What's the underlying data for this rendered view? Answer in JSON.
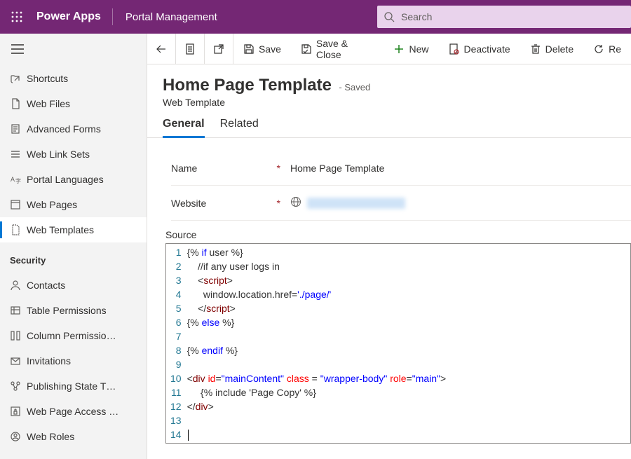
{
  "header": {
    "brand": "Power Apps",
    "app": "Portal Management",
    "search_placeholder": "Search"
  },
  "sidebar": {
    "items_top": [
      {
        "label": "Shortcuts",
        "icon": "shortcut"
      },
      {
        "label": "Web Files",
        "icon": "webfile"
      },
      {
        "label": "Advanced Forms",
        "icon": "form"
      },
      {
        "label": "Web Link Sets",
        "icon": "list"
      },
      {
        "label": "Portal Languages",
        "icon": "lang"
      },
      {
        "label": "Web Pages",
        "icon": "page"
      },
      {
        "label": "Web Templates",
        "icon": "template",
        "active": true
      }
    ],
    "section_label": "Security",
    "items_security": [
      {
        "label": "Contacts",
        "icon": "contact"
      },
      {
        "label": "Table Permissions",
        "icon": "tableperm"
      },
      {
        "label": "Column Permissio…",
        "icon": "colperm"
      },
      {
        "label": "Invitations",
        "icon": "invite"
      },
      {
        "label": "Publishing State T…",
        "icon": "pubstate"
      },
      {
        "label": "Web Page Access …",
        "icon": "access"
      },
      {
        "label": "Web Roles",
        "icon": "roles"
      }
    ]
  },
  "commands": {
    "save": "Save",
    "saveclose": "Save & Close",
    "new": "New",
    "deactivate": "Deactivate",
    "delete": "Delete",
    "refresh": "Re"
  },
  "page": {
    "title": "Home Page Template",
    "saved_suffix": "- Saved",
    "entity": "Web Template"
  },
  "tabs": [
    "General",
    "Related"
  ],
  "form": {
    "name_label": "Name",
    "name_value": "Home Page Template",
    "website_label": "Website",
    "source_label": "Source"
  },
  "source_lines": [
    {
      "n": 1,
      "html": "{% <span class='kw'>if</span> user %}"
    },
    {
      "n": 2,
      "html": "    //if any user logs in"
    },
    {
      "n": 3,
      "html": "    &lt;<span class='tag'>script</span>&gt;"
    },
    {
      "n": 4,
      "html": "      window.location.href=<span class='str'>'./page/'</span>"
    },
    {
      "n": 5,
      "html": "    &lt;/<span class='tag'>script</span>&gt;"
    },
    {
      "n": 6,
      "html": "{% <span class='kw'>else</span> %}"
    },
    {
      "n": 7,
      "html": ""
    },
    {
      "n": 8,
      "html": "{% <span class='kw'>endif</span> %}"
    },
    {
      "n": 9,
      "html": ""
    },
    {
      "n": 10,
      "html": "&lt;<span class='tag'>div</span> <span class='attr'>id</span>=<span class='str'>\"mainContent\"</span> <span class='attr'>class</span> = <span class='str'>\"wrapper-body\"</span> <span class='attr'>role</span>=<span class='str'>\"main\"</span>&gt;"
    },
    {
      "n": 11,
      "html": "     {% include 'Page Copy' %}"
    },
    {
      "n": 12,
      "html": "&lt;/<span class='tag'>div</span>&gt;"
    },
    {
      "n": 13,
      "html": ""
    },
    {
      "n": 14,
      "html": "<span class='cursor'></span>"
    }
  ]
}
